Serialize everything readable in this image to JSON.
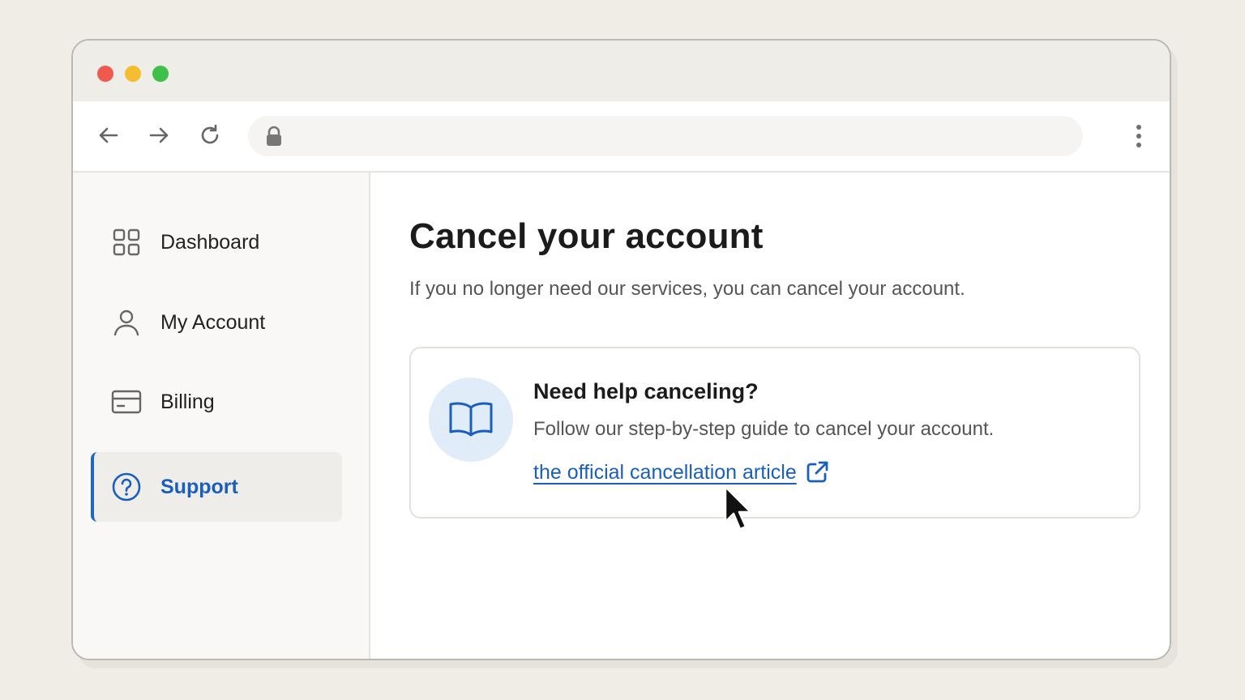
{
  "browser": {
    "icons": {
      "back": "arrow-left-icon",
      "forward": "arrow-right-icon",
      "reload": "reload-icon",
      "lock": "lock-icon",
      "menu": "kebab-menu-icon"
    },
    "address_value": ""
  },
  "sidebar": {
    "items": [
      {
        "label": "Dashboard",
        "icon": "grid-icon",
        "active": false
      },
      {
        "label": "My Account",
        "icon": "user-icon",
        "active": false
      },
      {
        "label": "Billing",
        "icon": "credit-card-icon",
        "active": false
      },
      {
        "label": "Support",
        "icon": "help-circle-icon",
        "active": true
      }
    ]
  },
  "main": {
    "title": "Cancel your account",
    "subtitle": "If you no longer need our services, you can cancel your account.",
    "help_card": {
      "icon": "book-icon",
      "title": "Need help canceling?",
      "description": "Follow our step-by-step guide to cancel your account.",
      "link_label": "the official cancellation article",
      "link_icon": "external-link-icon"
    }
  },
  "colors": {
    "accent": "#1a5fbb",
    "icon_bg": "#e1ecf9",
    "traffic_red": "#ef5a4f",
    "traffic_yellow": "#f5be30",
    "traffic_green": "#3fc04a"
  }
}
